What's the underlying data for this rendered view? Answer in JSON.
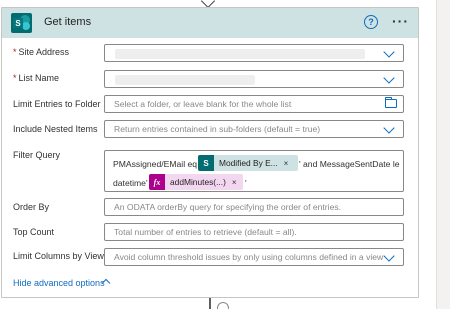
{
  "header": {
    "title": "Get items",
    "logo_letter": "S",
    "help_icon": "help-circle-icon",
    "more_icon": "more-icon"
  },
  "fields": {
    "site_address": {
      "label": "Site Address",
      "required_mark": "*"
    },
    "list_name": {
      "label": "List Name",
      "required_mark": "*"
    },
    "limit_folder": {
      "label": "Limit Entries to Folder",
      "placeholder": "Select a folder, or leave blank for the whole list"
    },
    "nested_items": {
      "label": "Include Nested Items",
      "placeholder": "Return entries contained in sub-folders (default = true)"
    },
    "filter_query": {
      "label": "Filter Query",
      "text_part1": "PMAssigned/EMail eq '",
      "token1_label": "Modified By E...",
      "token1_icon_letter": "S",
      "text_part2": "' and MessageSentDate le",
      "text_part3": "datetime'",
      "token2_label": "addMinutes(...)",
      "token2_icon_letter": "fx",
      "text_part4": "'",
      "close_glyph": "×"
    },
    "order_by": {
      "label": "Order By",
      "placeholder": "An ODATA orderBy query for specifying the order of entries."
    },
    "top_count": {
      "label": "Top Count",
      "placeholder": "Total number of entries to retrieve (default = all)."
    },
    "limit_columns": {
      "label": "Limit Columns by View",
      "placeholder": "Avoid column threshold issues by only using columns defined in a view"
    }
  },
  "advanced": {
    "label": "Hide advanced options"
  },
  "colors": {
    "header_bg": "#cfe2e3",
    "sharepoint_teal": "#036c70",
    "accent_blue": "#0f6cbd",
    "expression_magenta": "#ad008c",
    "expression_token_bg": "#f3d6f0",
    "required_red": "#a4262c"
  }
}
